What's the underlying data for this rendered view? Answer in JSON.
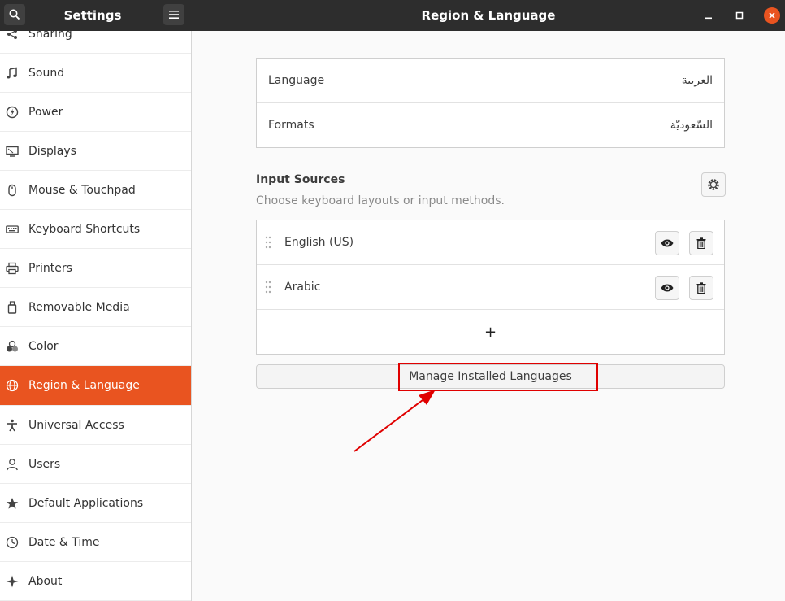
{
  "header": {
    "sidebar_title": "Settings",
    "main_title": "Region & Language",
    "close_color": "#e95420"
  },
  "sidebar": {
    "active_color": "#e95420",
    "items": [
      {
        "label": "Sharing",
        "icon": "share-icon"
      },
      {
        "label": "Sound",
        "icon": "music-note-icon"
      },
      {
        "label": "Power",
        "icon": "power-icon"
      },
      {
        "label": "Displays",
        "icon": "display-icon"
      },
      {
        "label": "Mouse & Touchpad",
        "icon": "mouse-icon"
      },
      {
        "label": "Keyboard Shortcuts",
        "icon": "keyboard-icon"
      },
      {
        "label": "Printers",
        "icon": "printer-icon"
      },
      {
        "label": "Removable Media",
        "icon": "usb-drive-icon"
      },
      {
        "label": "Color",
        "icon": "color-icon"
      },
      {
        "label": "Region & Language",
        "icon": "globe-icon",
        "active": true
      },
      {
        "label": "Universal Access",
        "icon": "accessibility-icon"
      },
      {
        "label": "Users",
        "icon": "user-icon"
      },
      {
        "label": "Default Applications",
        "icon": "star-icon"
      },
      {
        "label": "Date & Time",
        "icon": "clock-icon"
      },
      {
        "label": "About",
        "icon": "sparkle-icon"
      }
    ]
  },
  "main": {
    "language": {
      "label": "Language",
      "value": "العربية"
    },
    "formats": {
      "label": "Formats",
      "value": "السّعوديّة"
    },
    "input_sources": {
      "title": "Input Sources",
      "subtitle": "Choose keyboard layouts or input methods.",
      "sources": [
        {
          "name": "English (US)"
        },
        {
          "name": "Arabic"
        }
      ],
      "add_symbol": "+"
    },
    "manage_button": "Manage Installed Languages",
    "annotation_color": "#e00000"
  }
}
